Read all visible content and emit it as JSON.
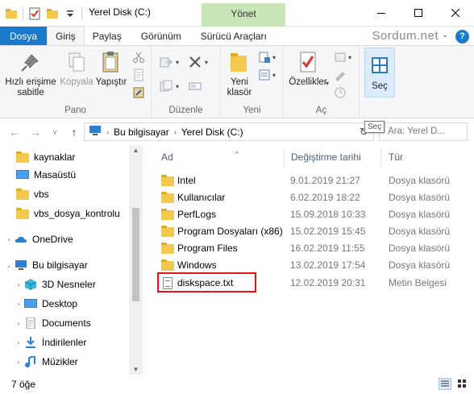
{
  "window": {
    "title": "Yerel Disk (C:)",
    "context_tab_header": "Yönet",
    "brand": "Sordum.net"
  },
  "tabs": [
    "Dosya",
    "Giriş",
    "Paylaş",
    "Görünüm",
    "Sürücü Araçları"
  ],
  "ribbon": {
    "pano": {
      "label": "Pano",
      "pin": "Hızlı erişime sabitle",
      "copy": "Kopyala",
      "paste": "Yapıştır"
    },
    "duzenle": {
      "label": "Düzenle"
    },
    "yeni": {
      "label": "Yeni",
      "new_folder": "Yeni klasör"
    },
    "ac": {
      "label": "Aç",
      "properties": "Özellikler"
    },
    "sec": {
      "label": "Seç"
    }
  },
  "address": {
    "crumbs": [
      "Bu bilgisayar",
      "Yerel Disk (C:)"
    ],
    "search_placeholder": "Ara: Yerel D...",
    "tooltip": "Seç"
  },
  "navpane": {
    "items": [
      {
        "label": "kaynaklar",
        "icon": "folder-icon"
      },
      {
        "label": "Masaüstü",
        "icon": "desktop-icon"
      },
      {
        "label": "vbs",
        "icon": "folder-icon"
      },
      {
        "label": "vbs_dosya_kontrolu",
        "icon": "folder-icon"
      },
      {
        "label": "OneDrive",
        "icon": "cloud-icon"
      },
      {
        "label": "Bu bilgisayar",
        "icon": "computer-icon"
      },
      {
        "label": "3D Nesneler",
        "icon": "cube-icon"
      },
      {
        "label": "Desktop",
        "icon": "desktop-icon"
      },
      {
        "label": "Documents",
        "icon": "documents-icon"
      },
      {
        "label": "İndirilenler",
        "icon": "download-icon"
      },
      {
        "label": "Müzikler",
        "icon": "music-icon"
      }
    ]
  },
  "filelist": {
    "columns": [
      "Ad",
      "Değiştirme tarihi",
      "Tür"
    ],
    "rows": [
      {
        "name": "Intel",
        "date": "9.01.2019 21:27",
        "type": "Dosya klasörü",
        "icon": "folder-icon"
      },
      {
        "name": "Kullanıcılar",
        "date": "6.02.2019 18:22",
        "type": "Dosya klasörü",
        "icon": "folder-icon"
      },
      {
        "name": "PerfLogs",
        "date": "15.09.2018 10:33",
        "type": "Dosya klasörü",
        "icon": "folder-icon"
      },
      {
        "name": "Program Dosyaları (x86)",
        "date": "15.02.2019 15:45",
        "type": "Dosya klasörü",
        "icon": "folder-icon"
      },
      {
        "name": "Program Files",
        "date": "16.02.2019 11:55",
        "type": "Dosya klasörü",
        "icon": "folder-icon"
      },
      {
        "name": "Windows",
        "date": "13.02.2019 17:54",
        "type": "Dosya klasörü",
        "icon": "folder-icon"
      },
      {
        "name": "diskspace.txt",
        "date": "12.02.2019 20:31",
        "type": "Metin Belgesi",
        "icon": "text-file-icon"
      }
    ]
  },
  "status": {
    "count": "7 öğe"
  },
  "colors": {
    "accent": "#1979ca",
    "context_tab": "#c7e5b6",
    "highlight": "#e8101a"
  }
}
